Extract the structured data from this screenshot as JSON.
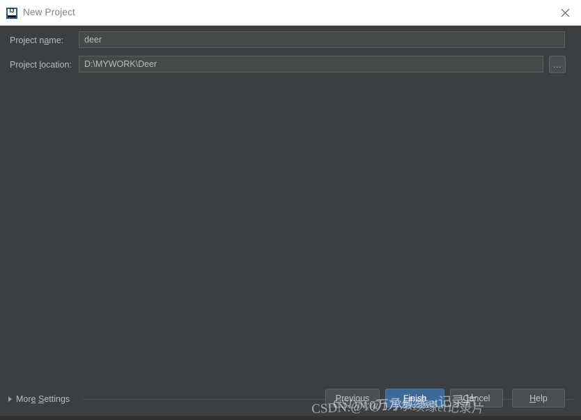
{
  "window": {
    "title": "New Project",
    "icon": "intellij-idea-icon",
    "close_label": "×"
  },
  "form": {
    "fields": [
      {
        "label_before": "Project n",
        "label_mnemonic": "a",
        "label_after": "me:",
        "value": "deer",
        "placeholder": ""
      },
      {
        "label_before": "Project ",
        "label_mnemonic": "l",
        "label_after": "ocation:",
        "value": "D:\\MYWORK\\Deer",
        "placeholder": ""
      }
    ],
    "browse_label": "..."
  },
  "more_settings": {
    "label_before": "Mor",
    "label_mnemonic_1": "e",
    "label_mid": " ",
    "label_mnemonic_2": "S",
    "label_after": "ettings",
    "expanded": false
  },
  "buttons": [
    {
      "id": "previous",
      "before": "",
      "mnemonic": "P",
      "after": "revious",
      "primary": false
    },
    {
      "id": "finish",
      "before": "",
      "mnemonic": "F",
      "after": "inish",
      "primary": true
    },
    {
      "id": "cancel",
      "before": "",
      "mnemonic": "C",
      "after": "ancel",
      "primary": false
    },
    {
      "id": "help",
      "before": "",
      "mnemonic": "H",
      "after": "elp",
      "primary": false
    }
  ],
  "watermark": {
    "line_a": "CSDN:@10万承续缘et记录片",
    "line_b": "CSDN:@1万承续缘et记录片"
  },
  "colors": {
    "titlebar_bg": "#ffffff",
    "dialog_bg": "#3c3f41",
    "input_bg": "#45494a",
    "input_border": "#5e6060",
    "text": "#bbbbbb",
    "title_text": "#808080",
    "button_bg": "#4a4e50",
    "button_border": "#5e6264",
    "primary_bg": "#3c6998",
    "primary_border": "#4d7cb0"
  }
}
